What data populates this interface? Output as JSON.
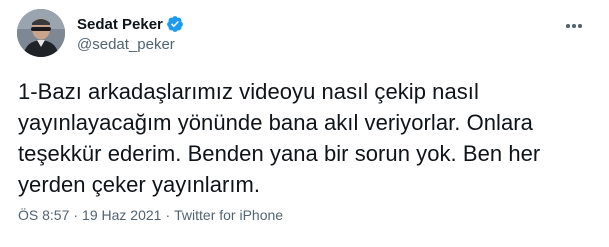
{
  "author": {
    "display_name": "Sedat Peker",
    "handle": "@sedat_peker",
    "verified": true,
    "verified_color": "#1d9bf0"
  },
  "tweet": {
    "text": "1-Bazı arkadaşlarımız videoyu nasıl çekip nasıl\nyayınlayacağım yönünde bana akıl veriyorlar. Onlara\nteşekkür ederim. Benden yana bir sorun yok. Ben her\nyerden çeker yayınlarım.",
    "time": "ÖS 8:57",
    "date": "19 Haz 2021",
    "source": "Twitter for iPhone",
    "separator": "·"
  },
  "icons": {
    "more": "more-horizontal-icon",
    "verified": "verified-badge-icon"
  },
  "colors": {
    "text_primary": "#0f1419",
    "text_secondary": "#536471",
    "background": "#ffffff"
  }
}
